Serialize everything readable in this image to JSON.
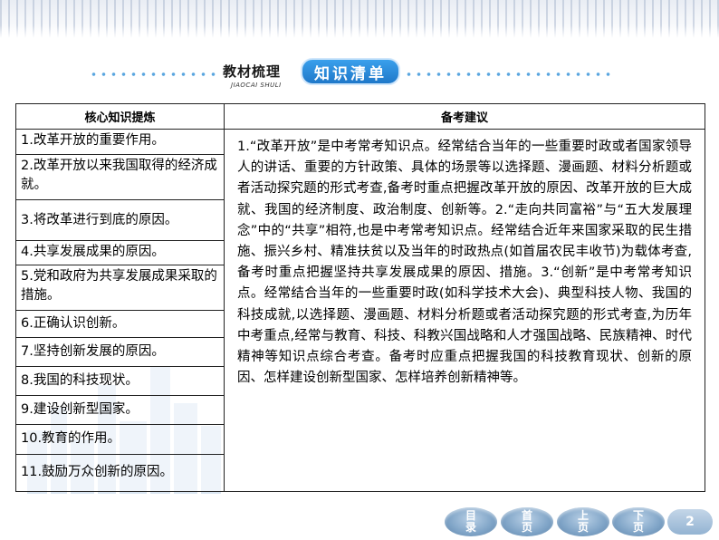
{
  "header": {
    "title": "教材梳理",
    "pinyin": "JIAOCAI SHULI",
    "badge": "知识清单"
  },
  "table": {
    "col_left_header": "核心知识提炼",
    "col_right_header": "备考建议",
    "knowledge_points": [
      "1.改革开放的重要作用。",
      "2.改革开放以来我国取得的经济成就。",
      "3.将改革进行到底的原因。",
      "4.共享发展成果的原因。",
      "5.党和政府为共享发展成果采取的措施。",
      "6.正确认识创新。",
      "7.坚持创新发展的原因。",
      "8.我国的科技现状。",
      "9.建设创新型国家。",
      "10.教育的作用。",
      "11.鼓励万众创新的原因。"
    ],
    "advice": "1.“改革开放”是中考常考知识点。经常结合当年的一些重要时政或者国家领导人的讲话、重要的方针政策、具体的场景等以选择题、漫画题、材料分析题或者活动探究题的形式考查,备考时重点把握改革开放的原因、改革开放的巨大成就、我国的经济制度、政治制度、创新等。2.“走向共同富裕”与“五大发展理念”中的“共享”相符,也是中考常考知识点。经常结合近年来国家采取的民生措施、振兴乡村、精准扶贫以及当年的时政热点(如首届农民丰收节)为载体考查,备考时重点把握坚持共享发展成果的原因、措施。3.“创新”是中考常考知识点。经常结合当年的一些重要时政(如科学技术大会)、典型科技人物、我国的科技成就,以选择题、漫画题、材料分析题或者活动探究题的形式考查,为历年中考重点,经常与教育、科技、科教兴国战略和人才强国战略、民族精神、时代精神等知识点综合考查。备考时应重点把握我国的科技教育现状、创新的原因、怎样建设创新型国家、怎样培养创新精神等。"
  },
  "nav": {
    "catalog": [
      "目",
      "录"
    ],
    "home": [
      "首",
      "页"
    ],
    "prev": [
      "上",
      "页"
    ],
    "next": [
      "下",
      "页"
    ],
    "page": "2"
  }
}
